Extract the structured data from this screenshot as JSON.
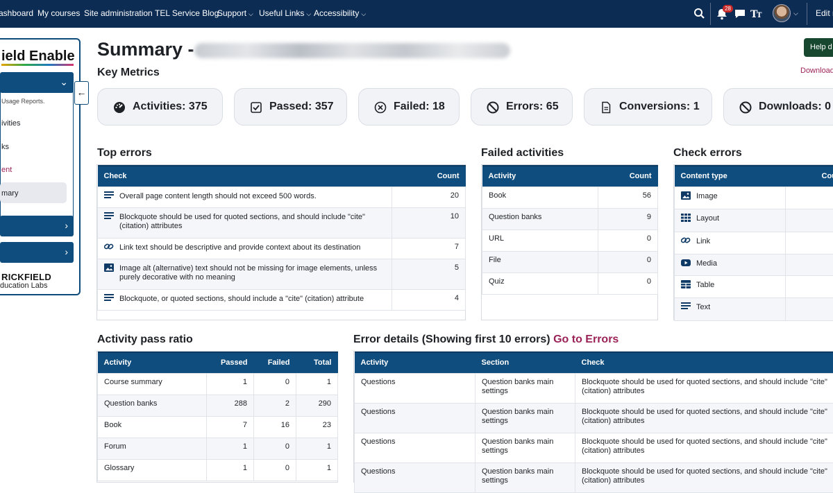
{
  "nav": {
    "items": [
      "ashboard",
      "My courses",
      "Site administration",
      "TEL Service Blog",
      "Support",
      "Useful Links",
      "Accessibility"
    ],
    "notification_count": "28",
    "edit_label": "Edit m"
  },
  "sidebar": {
    "logo": "ield Enable",
    "links": [
      "Usage Reports.",
      "ivities",
      "ks",
      "ent",
      "mary"
    ],
    "brand1": "RICKFIELD",
    "brand2": "ducation Labs",
    "collapse_icon": "arrow-left-icon"
  },
  "page": {
    "title": "Summary -",
    "help_label": "Help d",
    "download_label": "Download",
    "key_metrics": "Key Metrics"
  },
  "metrics": [
    {
      "label": "Activities: 375",
      "icon": "speedometer-icon"
    },
    {
      "label": "Passed: 357",
      "icon": "check-square-icon"
    },
    {
      "label": "Failed: 18",
      "icon": "x-circle-icon"
    },
    {
      "label": "Errors: 65",
      "icon": "ban-icon"
    },
    {
      "label": "Conversions: 1",
      "icon": "document-icon"
    },
    {
      "label": "Downloads: 0",
      "icon": "ban-icon"
    }
  ],
  "top_errors": {
    "title": "Top errors",
    "headers": [
      "Check",
      "Count"
    ],
    "rows": [
      {
        "check": "Overall page content length should not exceed 500 words.",
        "count": "20",
        "icon": "text-lines-icon"
      },
      {
        "check": "Blockquote should be used for quoted sections, and should include \"cite\" (citation) attributes",
        "count": "10",
        "icon": "text-lines-icon"
      },
      {
        "check": "Link text should be descriptive and provide context about its destination",
        "count": "7",
        "icon": "link-icon"
      },
      {
        "check": "Image alt (alternative) text should not be missing for image elements, unless purely decorative with no meaning",
        "count": "5",
        "icon": "image-icon"
      },
      {
        "check": "Blockquote, or quoted sections, should include a \"cite\" (citation) attribute",
        "count": "4",
        "icon": "text-lines-icon"
      }
    ]
  },
  "failed_activities": {
    "title": "Failed activities",
    "headers": [
      "Activity",
      "Count"
    ],
    "rows": [
      {
        "activity": "Book",
        "count": "56"
      },
      {
        "activity": "Question banks",
        "count": "9"
      },
      {
        "activity": "URL",
        "count": "0"
      },
      {
        "activity": "File",
        "count": "0"
      },
      {
        "activity": "Quiz",
        "count": "0"
      }
    ]
  },
  "check_errors": {
    "title": "Check errors",
    "headers": [
      "Content type",
      "Cou"
    ],
    "rows": [
      {
        "type": "Image",
        "icon": "image-icon"
      },
      {
        "type": "Layout",
        "icon": "grid-icon"
      },
      {
        "type": "Link",
        "icon": "link-icon"
      },
      {
        "type": "Media",
        "icon": "media-play-icon"
      },
      {
        "type": "Table",
        "icon": "table-icon"
      },
      {
        "type": "Text",
        "icon": "text-lines-icon"
      }
    ]
  },
  "pass_ratio": {
    "title": "Activity pass ratio",
    "headers": [
      "Activity",
      "Passed",
      "Failed",
      "Total"
    ],
    "rows": [
      {
        "activity": "Course summary",
        "passed": "1",
        "failed": "0",
        "total": "1"
      },
      {
        "activity": "Question banks",
        "passed": "288",
        "failed": "2",
        "total": "290"
      },
      {
        "activity": "Book",
        "passed": "7",
        "failed": "16",
        "total": "23"
      },
      {
        "activity": "Forum",
        "passed": "1",
        "failed": "0",
        "total": "1"
      },
      {
        "activity": "Glossary",
        "passed": "1",
        "failed": "0",
        "total": "1"
      }
    ]
  },
  "error_details": {
    "title": "Error details (Showing first 10 errors)",
    "link": "Go to Errors",
    "headers": [
      "Activity",
      "Section",
      "Check"
    ],
    "rows": [
      {
        "activity": "Questions",
        "section": "Question banks main settings",
        "check": "Blockquote should be used for quoted sections, and should include \"cite\" (citation) attributes"
      },
      {
        "activity": "Questions",
        "section": "Question banks main settings",
        "check": "Blockquote should be used for quoted sections, and should include \"cite\" (citation) attributes"
      },
      {
        "activity": "Questions",
        "section": "Question banks main settings",
        "check": "Blockquote should be used for quoted sections, and should include \"cite\" (citation) attributes"
      },
      {
        "activity": "Questions",
        "section": "Question banks main settings",
        "check": "Blockquote should be used for quoted sections, and should include \"cite\" (citation) attributes"
      }
    ]
  }
}
